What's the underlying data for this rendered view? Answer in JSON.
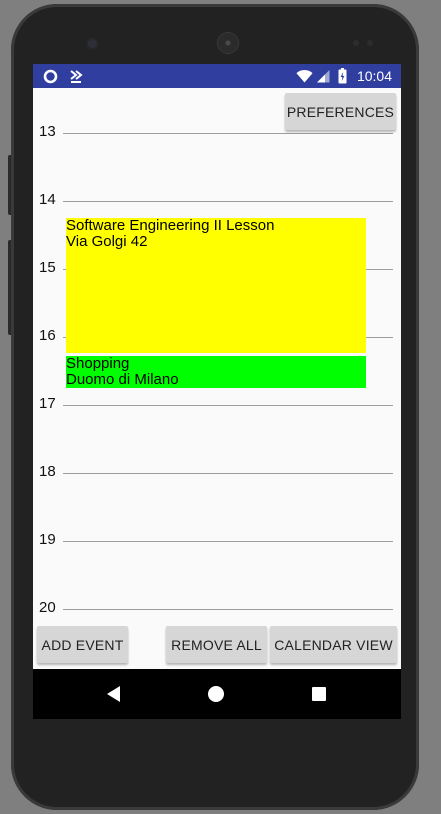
{
  "status_bar": {
    "time": "10:04",
    "icons": [
      "circle-icon",
      "download-icon",
      "wifi-icon",
      "signal-icon",
      "battery-icon"
    ],
    "color": "#303f9f"
  },
  "preferences_label": "PREFERENCES",
  "hours": [
    "13",
    "14",
    "15",
    "16",
    "17",
    "18",
    "19",
    "20"
  ],
  "events": [
    {
      "title": "Software Engineering II Lesson",
      "location": "Via Golgi 42",
      "color": "#ffff00"
    },
    {
      "title": "Shopping",
      "location": "Duomo di Milano",
      "color": "#00ff00"
    }
  ],
  "bottom_buttons": {
    "add_event": "ADD EVENT",
    "remove_all": "REMOVE ALL",
    "calendar_view": "CALENDAR VIEW"
  },
  "nav_bar": {
    "icons": [
      "back-icon",
      "home-icon",
      "recents-icon"
    ]
  }
}
